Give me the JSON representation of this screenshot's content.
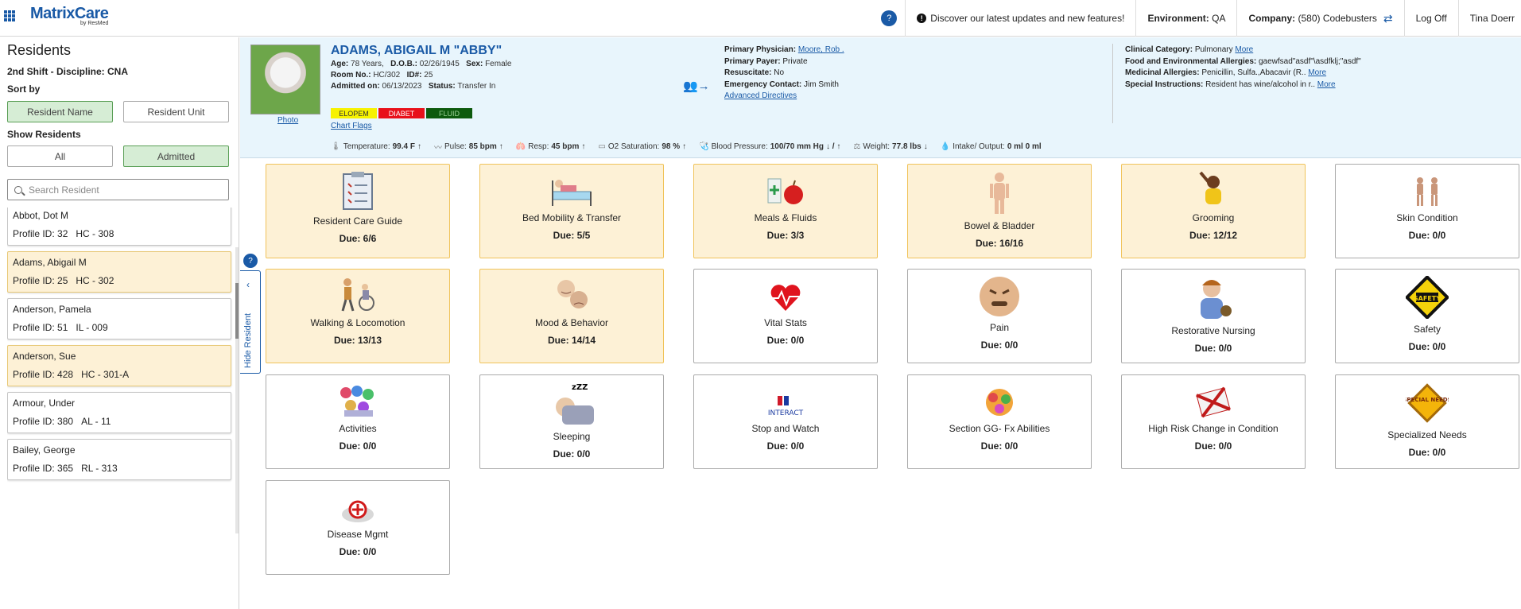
{
  "app": {
    "brand": "MatrixCare",
    "brand_by": "by ResMed",
    "announcement": "Discover our latest updates and new features!",
    "environment_label": "Environment:",
    "environment": "QA",
    "company_label": "Company:",
    "company": "(580) Codebusters",
    "logoff": "Log Off",
    "user": "Tina Doerr"
  },
  "sidebar": {
    "title": "Residents",
    "shift": "2nd Shift - Discipline: CNA",
    "sort_by_label": "Sort by",
    "sort_options": [
      "Resident Name",
      "Resident Unit"
    ],
    "show_label": "Show Residents",
    "show_options": [
      "All",
      "Admitted"
    ],
    "search_placeholder": "Search Resident",
    "residents": [
      {
        "name": "Abbot, Dot M",
        "pid": "Profile ID: 32",
        "unit": "HC - 308",
        "highlight": false
      },
      {
        "name": "Adams, Abigail M",
        "pid": "Profile ID: 25",
        "unit": "HC - 302",
        "highlight": true
      },
      {
        "name": "Anderson, Pamela",
        "pid": "Profile ID: 51",
        "unit": "IL - 009",
        "highlight": false
      },
      {
        "name": "Anderson, Sue",
        "pid": "Profile ID: 428",
        "unit": "HC - 301-A",
        "highlight": true
      },
      {
        "name": "Armour, Under",
        "pid": "Profile ID: 380",
        "unit": "AL - 11",
        "highlight": false
      },
      {
        "name": "Bailey, George",
        "pid": "Profile ID: 365",
        "unit": "RL - 313",
        "highlight": false
      }
    ],
    "hide_label": "Hide Resident"
  },
  "patient": {
    "name": "ADAMS, ABIGAIL M \"ABBY\"",
    "photo_link": "Photo",
    "age_label": "Age:",
    "age": "78 Years,",
    "dob_label": "D.O.B.:",
    "dob": "02/26/1945",
    "sex_label": "Sex:",
    "sex": "Female",
    "room_label": "Room No.:",
    "room": "HC/302",
    "id_label": "ID#:",
    "id": "25",
    "admitted_label": "Admitted on:",
    "admitted": "06/13/2023",
    "status_label": "Status:",
    "status": "Transfer In",
    "flags": [
      {
        "label": "ELOPEM",
        "bg": "#f7f200",
        "fg": "#333"
      },
      {
        "label": "DIABET",
        "bg": "#e8101a",
        "fg": "#fff"
      },
      {
        "label": "FLUID",
        "bg": "#0d5a0d",
        "fg": "#9fd39a"
      }
    ],
    "chart_flags": "Chart Flags",
    "physician_label": "Primary Physician:",
    "physician": "Moore, Rob .",
    "payer_label": "Primary Payer:",
    "payer": "Private",
    "resuscitate_label": "Resuscitate:",
    "resuscitate": "No",
    "emergency_label": "Emergency Contact:",
    "emergency": "Jim Smith",
    "advanced_directives": "Advanced Directives",
    "clinical_label": "Clinical Category:",
    "clinical": "Pulmonary",
    "food_label": "Food and Environmental Allergies:",
    "food": "gaewfsad\"asdf\"\\asdfklj;\"asdf\"",
    "med_label": "Medicinal Allergies:",
    "med": "Penicillin, Sulfa.,Abacavir (R..",
    "special_label": "Special Instructions:",
    "special": "Resident has wine/alcohol in r..",
    "more": "More"
  },
  "vitals": [
    {
      "label": "Temperature:",
      "value": "99.4 F",
      "arrow": "↑"
    },
    {
      "label": "Pulse:",
      "value": "85 bpm",
      "arrow": "↑"
    },
    {
      "label": "Resp:",
      "value": "45 bpm",
      "arrow": "↑"
    },
    {
      "label": "O2 Saturation:",
      "value": "98 %",
      "arrow": "↑"
    },
    {
      "label": "Blood Pressure:",
      "value": "100/70 mm Hg",
      "arrow": "↓ / ↑"
    },
    {
      "label": "Weight:",
      "value": "77.8 lbs",
      "arrow": "↓"
    },
    {
      "label": "Intake/ Output:",
      "value": "0 ml   0 ml",
      "arrow": ""
    }
  ],
  "tiles": [
    {
      "label": "Resident Care Guide",
      "due": "Due: 6/6",
      "active": true,
      "icon": "clipboard-icon"
    },
    {
      "label": "Bed Mobility & Transfer",
      "due": "Due: 5/5",
      "active": true,
      "icon": "bed-icon"
    },
    {
      "label": "Meals & Fluids",
      "due": "Due: 3/3",
      "active": true,
      "icon": "meals-icon"
    },
    {
      "label": "Bowel & Bladder",
      "due": "Due: 16/16",
      "active": true,
      "icon": "body-icon"
    },
    {
      "label": "Grooming",
      "due": "Due: 12/12",
      "active": true,
      "icon": "grooming-icon"
    },
    {
      "label": "Skin Condition",
      "due": "Due: 0/0",
      "active": false,
      "icon": "skin-icon"
    },
    {
      "label": "Walking & Locomotion",
      "due": "Due: 13/13",
      "active": true,
      "icon": "walking-icon"
    },
    {
      "label": "Mood & Behavior",
      "due": "Due: 14/14",
      "active": true,
      "icon": "mood-icon"
    },
    {
      "label": "Vital Stats",
      "due": "Due: 0/0",
      "active": false,
      "icon": "heart-icon"
    },
    {
      "label": "Pain",
      "due": "Due: 0/0",
      "active": false,
      "icon": "pain-face-icon"
    },
    {
      "label": "Restorative Nursing",
      "due": "Due: 0/0",
      "active": false,
      "icon": "nurse-icon"
    },
    {
      "label": "Safety",
      "due": "Due: 0/0",
      "active": false,
      "icon": "safety-sign-icon"
    },
    {
      "label": "Activities",
      "due": "Due: 0/0",
      "active": false,
      "icon": "activities-icon"
    },
    {
      "label": "Sleeping",
      "due": "Due: 0/0",
      "active": false,
      "icon": "sleeping-icon"
    },
    {
      "label": "Stop and Watch",
      "due": "Due: 0/0",
      "active": false,
      "icon": "interact-icon",
      "icon_text": "INTERACT"
    },
    {
      "label": "Section GG- Fx Abilities",
      "due": "Due: 0/0",
      "active": false,
      "icon": "gg-icon"
    },
    {
      "label": "High Risk Change in Condition",
      "due": "Due: 0/0",
      "active": false,
      "icon": "risk-icon"
    },
    {
      "label": "Specialized Needs",
      "due": "Due: 0/0",
      "active": false,
      "icon": "special-needs-icon",
      "icon_text": "SPECIAL NEEDS"
    },
    {
      "label": "Disease Mgmt",
      "due": "Due: 0/0",
      "active": false,
      "icon": "disease-icon"
    }
  ]
}
